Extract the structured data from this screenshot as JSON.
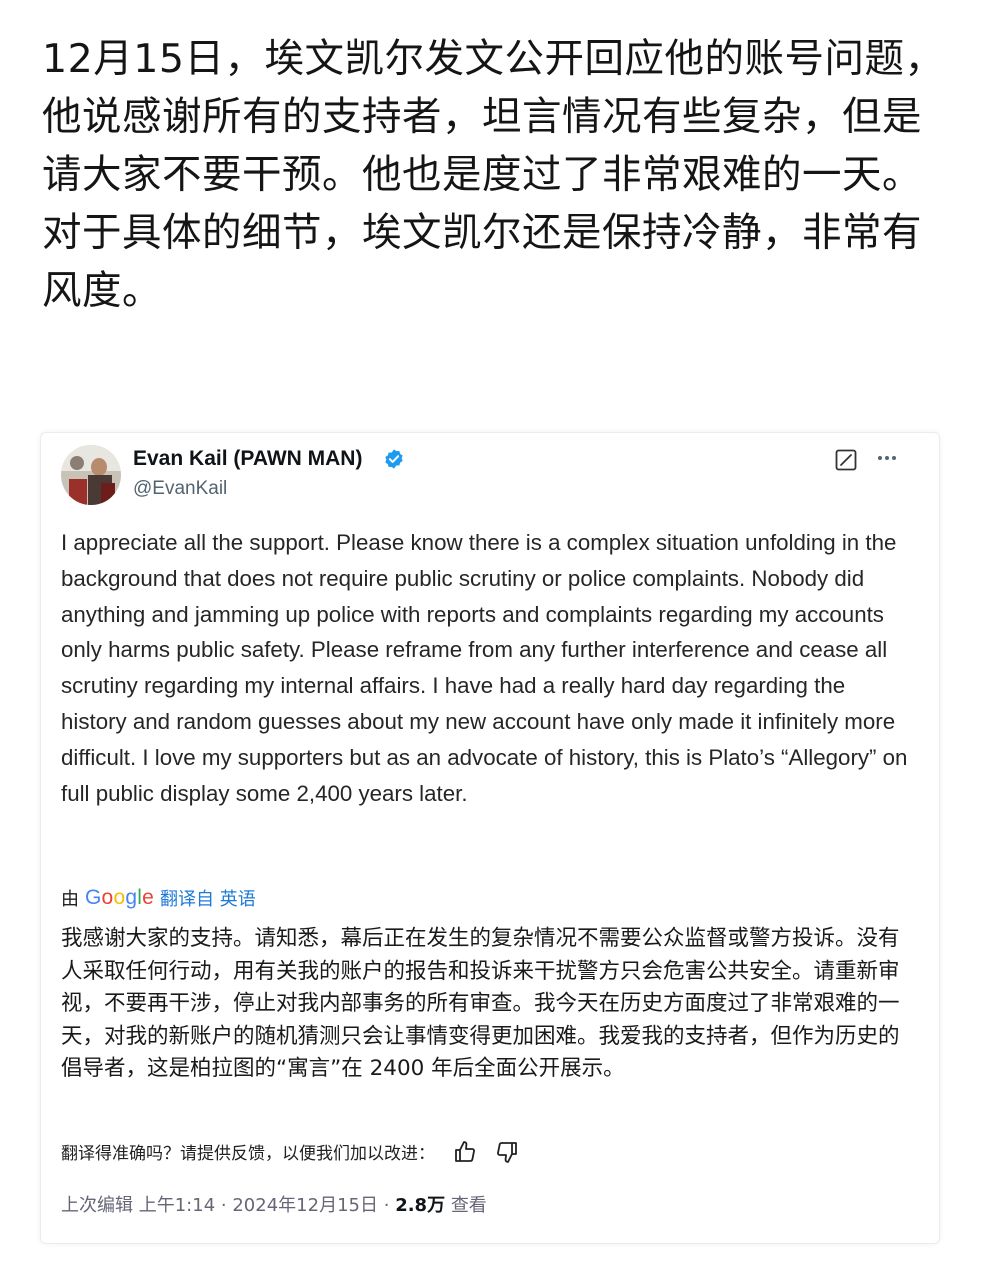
{
  "post": {
    "text": "12月15日，埃文凯尔发文公开回应他的账号问题，他说感谢所有的支持者，坦言情况有些复杂，但是请大家不要干预。他也是度过了非常艰难的一天。对于具体的细节，埃文凯尔还是保持冷静，非常有风度。"
  },
  "tweet": {
    "author_name": "Evan Kail (PAWN MAN)",
    "handle": "@EvanKail",
    "body": "I appreciate all the support. Please know there is a complex situation unfolding in the background that does not require public scrutiny or police complaints. Nobody did anything and jamming up police with reports and complaints regarding my accounts only harms public safety. Please reframe from any further interference and cease all scrutiny regarding my internal affairs. I have had a really hard day regarding the history and random guesses about my new account have only made it infinitely more difficult. I love my supporters but as an advocate of history, this is Plato’s “Allegory” on full public display some 2,400 years later.",
    "translated_prefix": "由",
    "google_logo": "Google",
    "translated_link": "翻译自 英语",
    "translation": "我感谢大家的支持。请知悉，幕后正在发生的复杂情况不需要公众监督或警方投诉。没有人采取任何行动，用有关我的账户的报告和投诉来干扰警方只会危害公共安全。请重新审视，不要再干涉，停止对我内部事务的所有审查。我今天在历史方面度过了非常艰难的一天，对我的新账户的随机猜测只会让事情变得更加困难。我爱我的支持者，但作为历史的倡导者，这是柏拉图的“寓言”在 2400 年后全面公开展示。",
    "feedback_prompt": "翻译得准确吗？请提供反馈，以便我们加以改进：",
    "edited_label": "上次编辑",
    "time": "上午1:14",
    "date": "2024年12月15日",
    "views_count": "2.8万",
    "views_label": "查看",
    "sep": "·"
  },
  "icons": {
    "verified": "verified-badge-icon",
    "grok": "grok-icon",
    "more": "more-icon",
    "thumbs_up": "thumbs-up-icon",
    "thumbs_down": "thumbs-down-icon"
  },
  "colors": {
    "verified_blue": "#1d9bf0",
    "link_blue": "#1d7bd8",
    "muted_gray": "#536471"
  }
}
